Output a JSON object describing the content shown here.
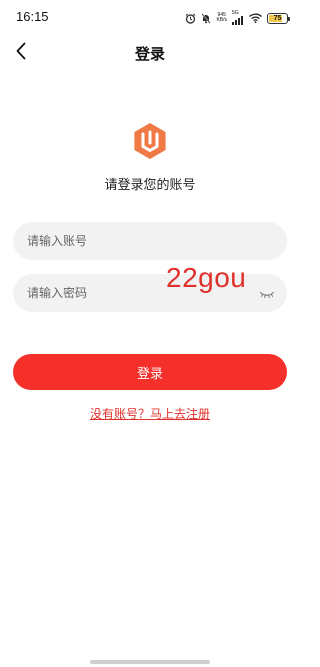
{
  "status_bar": {
    "time": "16:15",
    "net_speed_value": "945",
    "net_speed_unit": "KB/s",
    "network_type": "5G",
    "battery_level": "75",
    "battery_fraction": 0.75,
    "icons": [
      "alarm-icon",
      "mute-icon",
      "signal-icon",
      "wifi-icon",
      "battery-icon"
    ]
  },
  "nav": {
    "title": "登录",
    "back_icon": "chevron-left-icon"
  },
  "brand": {
    "logo_icon": "app-logo-icon",
    "logo_color": "#f07a45",
    "subtitle": "请登录您的账号"
  },
  "form": {
    "account_placeholder": "请输入账号",
    "account_value": "",
    "password_placeholder": "请输入密码",
    "password_value": "",
    "password_toggle_icon": "eye-closed-icon"
  },
  "watermark": "22gou",
  "actions": {
    "login_label": "登录",
    "login_color": "#f5302b",
    "register_link": "没有账号？马上去注册"
  }
}
